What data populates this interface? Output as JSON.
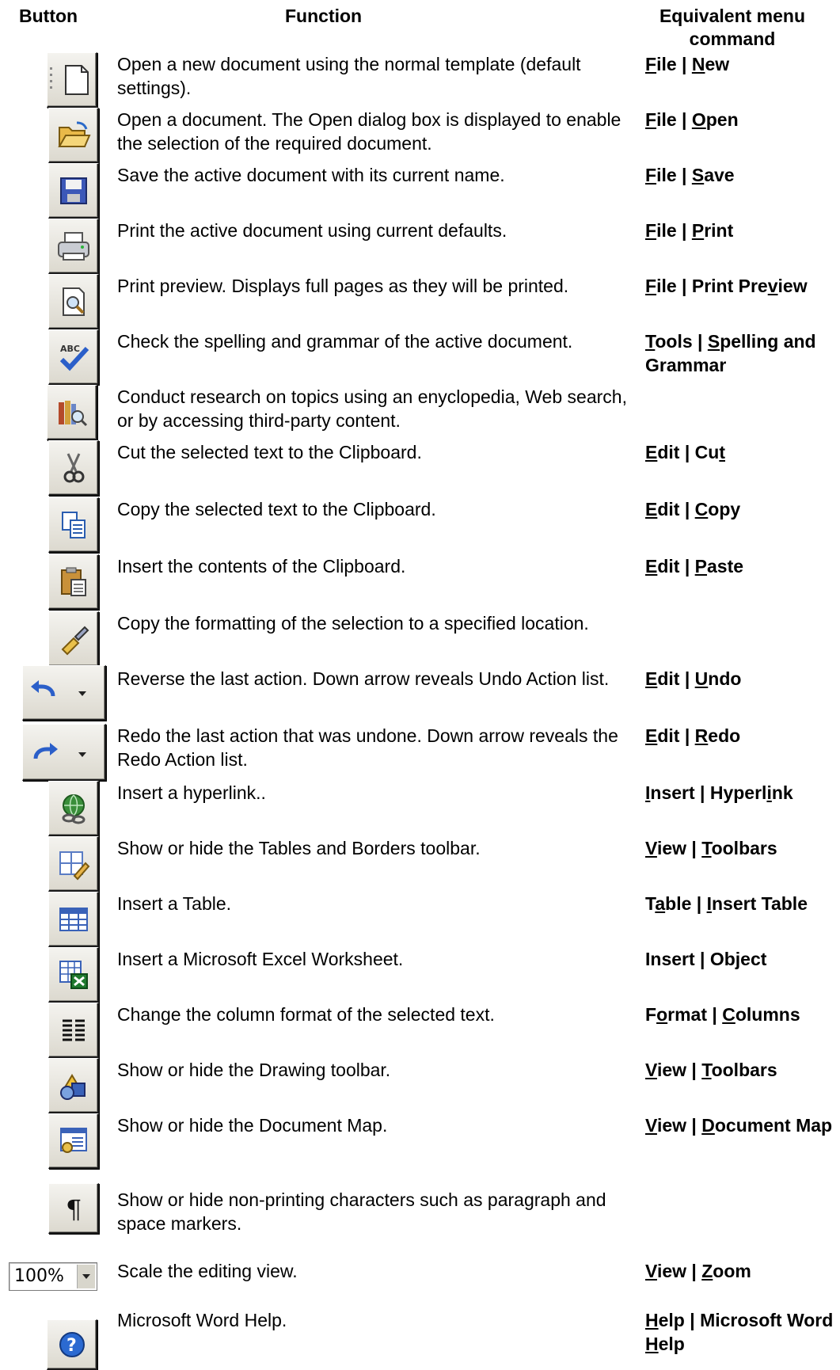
{
  "headers": {
    "button": "Button",
    "function": "Function",
    "menu": "Equivalent menu command"
  },
  "rows": [
    {
      "icon": "new-document-icon",
      "function": "Open a new document using the normal template (default settings).",
      "menu_html": "<u>F</u>ile | <u>N</u>ew"
    },
    {
      "icon": "open-folder-icon",
      "function": "Open a document. The Open dialog box is displayed to enable the selection of the required document.",
      "menu_html": "<u>F</u>ile | <u>O</u>pen"
    },
    {
      "icon": "save-disk-icon",
      "function": "Save the active document with its current name.",
      "menu_html": "<u>F</u>ile | <u>S</u>ave"
    },
    {
      "icon": "printer-icon",
      "function": "Print the active document using current defaults.",
      "menu_html": "<u>F</u>ile | <u>P</u>rint"
    },
    {
      "icon": "print-preview-icon",
      "function": "Print preview. Displays full pages as they will be printed.",
      "menu_html": "<u>F</u>ile | Print Pre<u>v</u>iew"
    },
    {
      "icon": "spelling-grammar-icon",
      "function": "Check the spelling and grammar of the active document.",
      "menu_html": "<u>T</u>ools | <u>S</u>pelling and Grammar"
    },
    {
      "icon": "research-icon",
      "function": "Conduct research on topics using an enyclopedia, Web search, or by accessing third-party content.",
      "menu_html": ""
    },
    {
      "icon": "cut-scissors-icon",
      "function": "Cut the selected text to the Clipboard.",
      "menu_html": "<u>E</u>dit | Cu<u>t</u>"
    },
    {
      "icon": "copy-icon",
      "function": "Copy the selected text to the Clipboard.",
      "menu_html": "<u>E</u>dit | <u>C</u>opy"
    },
    {
      "icon": "paste-clipboard-icon",
      "function": "Insert the contents of the Clipboard.",
      "menu_html": "<u>E</u>dit | <u>P</u>aste"
    },
    {
      "icon": "format-painter-icon",
      "function": "Copy the formatting of the selection to a specified location.",
      "menu_html": ""
    },
    {
      "icon": "undo-icon",
      "function": "Reverse the last action. Down arrow reveals Undo Action list.",
      "menu_html": "<u>E</u>dit | <u>U</u>ndo"
    },
    {
      "icon": "redo-icon",
      "function": "Redo the last action that was undone. Down arrow reveals the Redo Action list.",
      "menu_html": "<u>E</u>dit | <u>R</u>edo"
    },
    {
      "icon": "hyperlink-globe-icon",
      "function": "Insert a hyperlink..",
      "menu_html": "<u>I</u>nsert | Hyperl<u>i</u>nk"
    },
    {
      "icon": "tables-borders-icon",
      "function": "Show or hide the Tables and Borders toolbar.",
      "menu_html": "<u>V</u>iew | <u>T</u>oolbars"
    },
    {
      "icon": "insert-table-icon",
      "function": "Insert a Table.",
      "menu_html": "T<u>a</u>ble | <u>I</u>nsert Table"
    },
    {
      "icon": "excel-worksheet-icon",
      "function": "Insert a Microsoft Excel Worksheet.",
      "menu_html": "Insert | Object"
    },
    {
      "icon": "columns-icon",
      "function": "Change the column format of the selected text.",
      "menu_html": "F<u>o</u>rmat | <u>C</u>olumns"
    },
    {
      "icon": "drawing-shapes-icon",
      "function": "Show or hide the Drawing toolbar.",
      "menu_html": "<u>V</u>iew | <u>T</u>oolbars"
    },
    {
      "icon": "document-map-icon",
      "function": "Show or hide the Document Map.",
      "menu_html": "<u>V</u>iew | <u>D</u>ocument Map"
    },
    {
      "icon": "pilcrow-icon",
      "function": "Show or hide non-printing characters such as paragraph and space markers.",
      "menu_html": ""
    },
    {
      "icon": "zoom-dropdown-icon",
      "zoom_value": "100%",
      "function": "Scale the editing view.",
      "menu_html": "<u>V</u>iew | <u>Z</u>oom"
    },
    {
      "icon": "help-icon",
      "function": "Microsoft Word Help.",
      "menu_html": "<u>H</u>elp | Microsoft Word <u>H</u>elp"
    }
  ]
}
